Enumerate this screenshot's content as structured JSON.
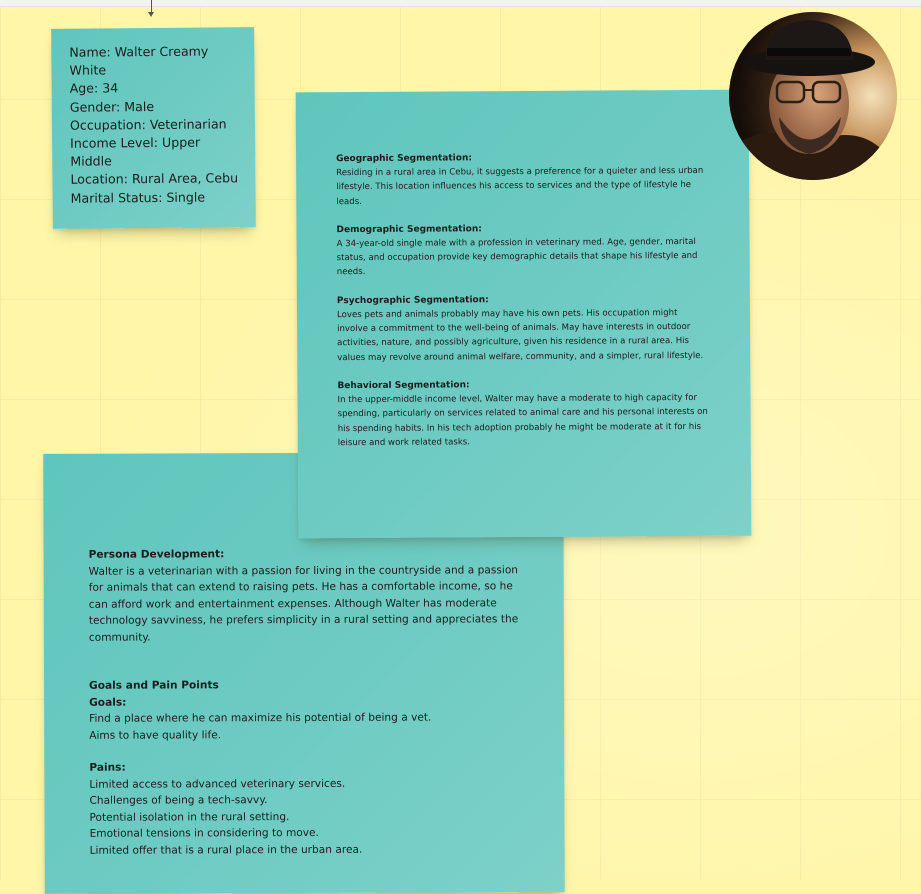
{
  "profile": {
    "lines": [
      "Name: Walter Creamy",
      "White",
      "Age: 34",
      "Gender: Male",
      "Occupation: Veterinarian",
      "Income Level: Upper",
      "Middle",
      "Location: Rural Area, Cebu",
      "Marital Status: Single"
    ]
  },
  "segmentation": [
    {
      "title": "Geographic Segmentation:",
      "body": "Residing in a rural area in Cebu, it suggests a preference for a quieter and less urban lifestyle. This location influences his access to services and the type of lifestyle he leads."
    },
    {
      "title": "Demographic Segmentation:",
      "body": "A 34-year-old single male with a profession in veterinary med. Age, gender, marital status, and occupation provide key demographic details that shape his lifestyle and needs."
    },
    {
      "title": "Psychographic Segmentation:",
      "body": "Loves pets and animals probably may have his own pets. His occupation might involve a commitment to the well-being of animals. May have interests in outdoor activities, nature, and possibly agriculture, given his residence in a rural area. His values may revolve around animal welfare, community, and a simpler, rural lifestyle."
    },
    {
      "title": "Behavioral Segmentation:",
      "body": "In the upper-middle income level, Walter may have a moderate to high capacity for spending, particularly on services related to animal care and his personal interests on his spending habits. In his tech adoption probably he might be moderate at it for his leisure and work related tasks."
    }
  ],
  "persona": {
    "title": "Persona Development:",
    "body": "Walter is a veterinarian with a passion for living in the countryside and a passion for animals that can extend to raising pets. He has a comfortable income, so he can afford work and entertainment expenses. Although Walter has moderate technology savviness, he prefers simplicity in a rural setting and appreciates the community.",
    "goals_pains_title": "Goals and Pain Points",
    "goals_label": "Goals:",
    "goals": [
      "Find a place where he can maximize his potential of being a vet.",
      "Aims to have quality life."
    ],
    "pains_label": "Pains:",
    "pains": [
      "Limited access to advanced veterinary services.",
      "Challenges of being a tech-savvy.",
      "Potential isolation in the rural setting.",
      "Emotional tensions in considering to move.",
      "Limited offer that is a rural place in the urban area."
    ]
  },
  "colors": {
    "board": "#fff6a8",
    "sticky": "#6ecbc3"
  },
  "avatar_icon": "persona-photo"
}
